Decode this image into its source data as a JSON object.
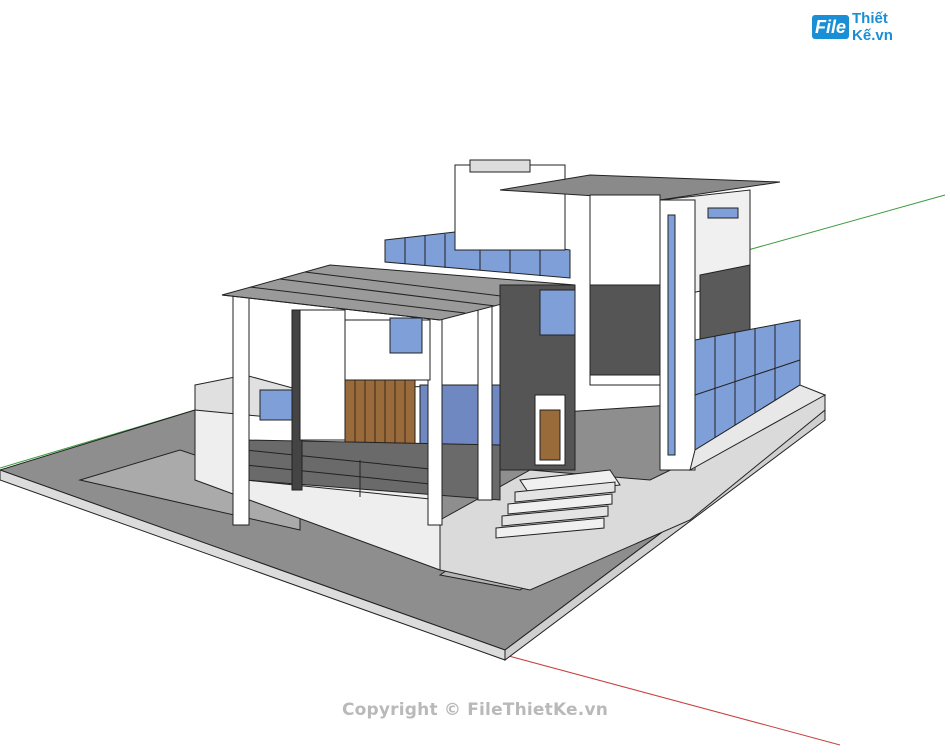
{
  "logo": {
    "mark": "File",
    "text": "Thiết Kế.vn"
  },
  "watermark": {
    "text": "Copyright © FileThietKe.vn"
  },
  "scene": {
    "subject": "house-3d-model",
    "axes": {
      "green": "#3c9a3c",
      "red": "#c84040"
    },
    "colors": {
      "glass": "#7f9fd8",
      "wall": "#f2f2f2",
      "dark": "#5a5a5a",
      "ground": "#8c8c8c",
      "wood": "#9a6b3a"
    }
  }
}
